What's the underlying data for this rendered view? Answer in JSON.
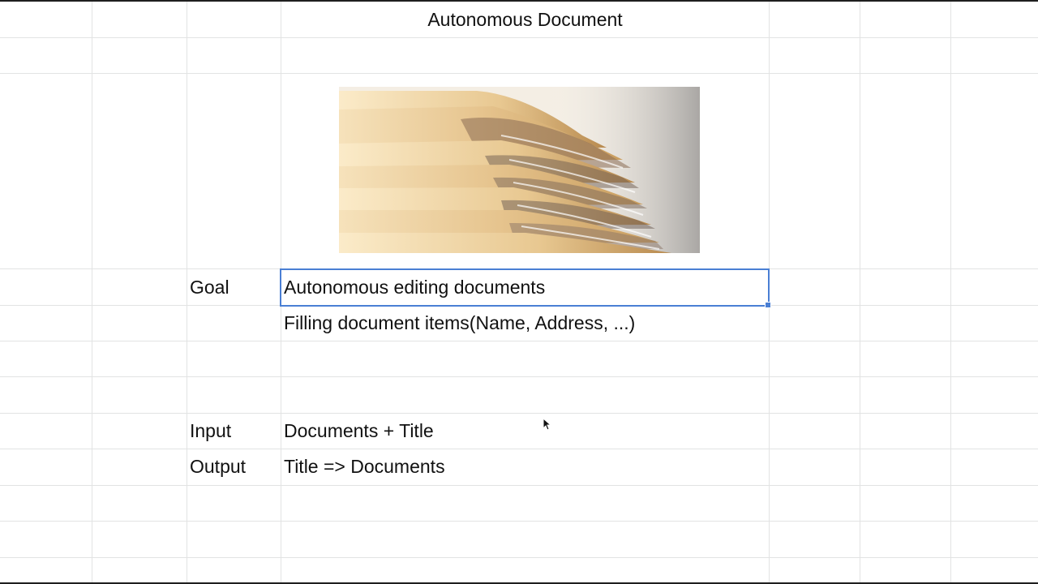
{
  "sheet": {
    "title": "Autonomous Document",
    "rows": {
      "goal_label": "Goal",
      "goal_value": "Autonomous editing documents",
      "goal_detail": "Filling document items(Name, Address, ...)",
      "input_label": "Input",
      "input_value": "Documents + Title",
      "output_label": "Output",
      "output_value": "Title => Documents"
    },
    "image": {
      "icon": "document-stack-photo"
    },
    "colors": {
      "selection": "#4a7fd4",
      "gridline": "#e2e3e3",
      "text": "#111111"
    }
  }
}
